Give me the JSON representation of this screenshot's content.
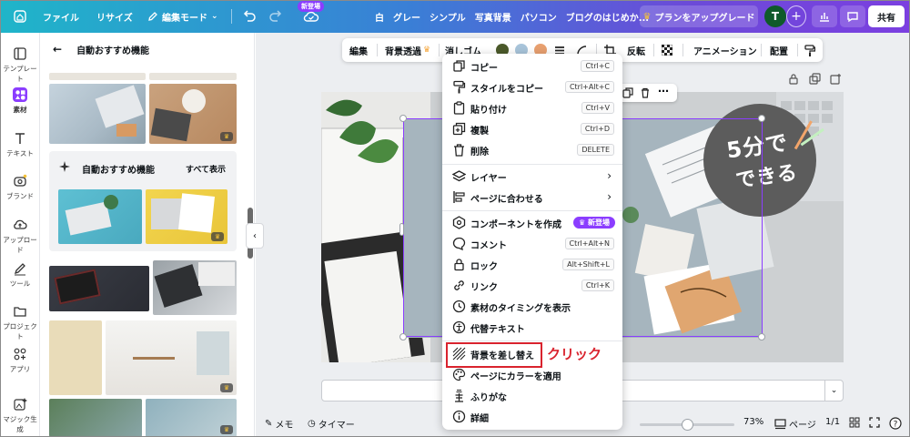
{
  "topbar": {
    "file": "ファイル",
    "resize": "リサイズ",
    "edit_mode": "編集モード",
    "new_badge": "新登場",
    "title": "白　グレー　シンプル　写真背景　パソコン　ブログのはじめか...",
    "upgrade": "プランをアップグレード",
    "avatar_initial": "T",
    "share": "共有"
  },
  "rail": {
    "items": [
      {
        "label": "テンプレート"
      },
      {
        "label": "素材"
      },
      {
        "label": "テキスト"
      },
      {
        "label": "ブランド"
      },
      {
        "label": "アップロード"
      },
      {
        "label": "ツール"
      },
      {
        "label": "プロジェクト"
      },
      {
        "label": "アプリ"
      },
      {
        "label": "マジック生成"
      }
    ]
  },
  "panel": {
    "header": "自動おすすめ機能",
    "section_title": "自動おすすめ機能",
    "see_all": "すべて表示"
  },
  "toolbar": {
    "edit": "編集",
    "bg_remove": "背景透過",
    "eraser": "消しゴム",
    "flip": "反転",
    "animation": "アニメーション",
    "position": "配置",
    "swatches": [
      "#4b5a2a",
      "#a8c4da",
      "#e8a070"
    ]
  },
  "canvas": {
    "overlay_text_1": "5分で",
    "overlay_text_2": "できる"
  },
  "context_menu": {
    "items": [
      {
        "label": "コピー",
        "shortcut": "Ctrl+C"
      },
      {
        "label": "スタイルをコピー",
        "shortcut": "Ctrl+Alt+C"
      },
      {
        "label": "貼り付け",
        "shortcut": "Ctrl+V"
      },
      {
        "label": "複製",
        "shortcut": "Ctrl+D"
      },
      {
        "label": "削除",
        "shortcut": "DELETE"
      },
      {
        "label": "レイヤー"
      },
      {
        "label": "ページに合わせる"
      },
      {
        "label": "コンポーネントを作成",
        "badge": "新登場"
      },
      {
        "label": "コメント",
        "shortcut": "Ctrl+Alt+N"
      },
      {
        "label": "ロック",
        "shortcut": "Alt+Shift+L"
      },
      {
        "label": "リンク",
        "shortcut": "Ctrl+K"
      },
      {
        "label": "素材のタイミングを表示"
      },
      {
        "label": "代替テキスト"
      },
      {
        "label": "背景を差し替え"
      },
      {
        "label": "ページにカラーを適用"
      },
      {
        "label": "ふりがな"
      },
      {
        "label": "詳細"
      }
    ]
  },
  "annotation": {
    "click_label": "クリック",
    "color": "#d9232e"
  },
  "bottom": {
    "notes": "メモ",
    "timer": "タイマー",
    "zoom": "73%",
    "zoom_fraction": 0.5,
    "pages": "ページ",
    "page_count": "1/1"
  },
  "colors": {
    "accent": "#8b3dff",
    "topbar_gradient_start": "#1fb5c9",
    "topbar_gradient_end": "#7b3fe0"
  }
}
